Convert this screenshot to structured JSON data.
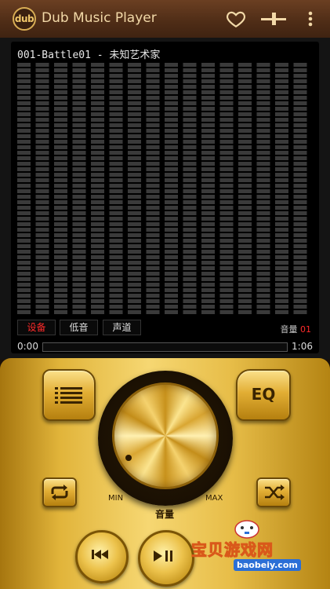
{
  "app": {
    "logo_text": "dub",
    "title": "Dub Music Player"
  },
  "display": {
    "song_title": "001-Battle01 - 未知艺术家",
    "buttons": {
      "device": "设备",
      "bass": "低音",
      "channel": "声道"
    },
    "volume_label": "音量",
    "volume_value": "01",
    "time_current": "0:00",
    "time_total": "1:06",
    "progress": 0.0
  },
  "controls": {
    "eq_label": "EQ",
    "knob_min": "MIN",
    "knob_max": "MAX",
    "knob_label": "音量"
  },
  "watermark": {
    "text": "宝贝游戏网",
    "url": "baobeiy.com"
  },
  "colors": {
    "accent_red": "#ff2a2a",
    "gold": "#e7bd48",
    "wood": "#5a321a"
  },
  "icons": [
    "heart-icon",
    "equalizer-slider-icon",
    "more-vert-icon",
    "playlist-icon",
    "repeat-icon",
    "shuffle-icon",
    "previous-icon",
    "play-pause-icon"
  ]
}
